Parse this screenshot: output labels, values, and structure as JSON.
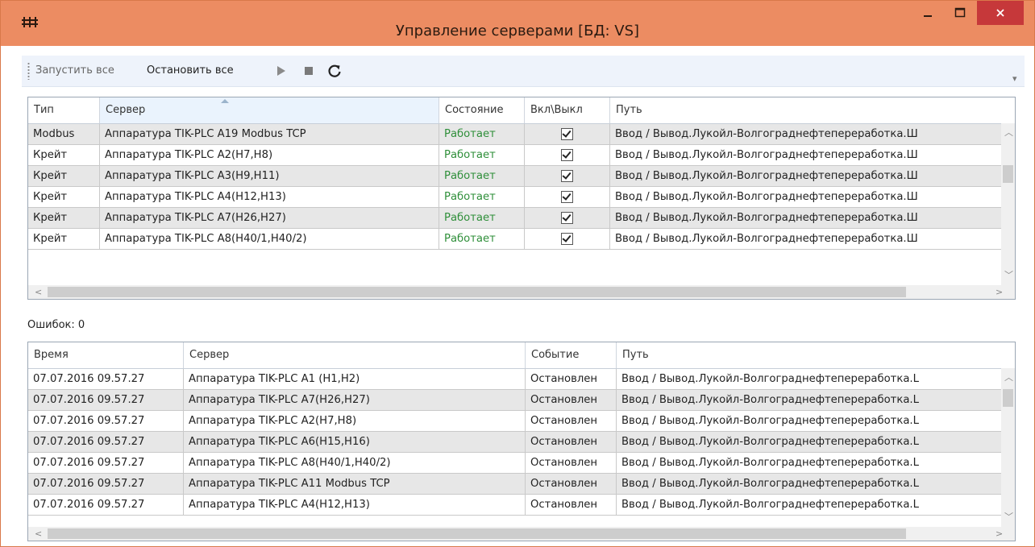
{
  "window": {
    "title": "Управление серверами [БД: VS]",
    "app_icon": "rack-icon",
    "accent": "#ec8c62",
    "close_color": "#c6383a"
  },
  "toolbar": {
    "start_all": "Запустить все",
    "stop_all": "Остановить все",
    "icons": [
      "play-icon",
      "stop-icon",
      "refresh-icon"
    ]
  },
  "servers": {
    "headers": [
      "Тип",
      "Сервер",
      "Состояние",
      "Вкл\\Выкл",
      "Путь"
    ],
    "sorted_column": "Сервер",
    "rows": [
      {
        "type": "Modbus",
        "server": "Аппаратура TIK-PLC A19 Modbus TCP",
        "state": "Работает",
        "enabled": true,
        "path": "Ввод / Вывод.Лукойл-Волгограднефтепереработка.Ш"
      },
      {
        "type": "Крейт",
        "server": "Аппаратура TIK-PLC A2(H7,H8)",
        "state": "Работает",
        "enabled": true,
        "path": "Ввод / Вывод.Лукойл-Волгограднефтепереработка.Ш"
      },
      {
        "type": "Крейт",
        "server": "Аппаратура TIK-PLC A3(H9,H11)",
        "state": "Работает",
        "enabled": true,
        "path": "Ввод / Вывод.Лукойл-Волгограднефтепереработка.Ш"
      },
      {
        "type": "Крейт",
        "server": "Аппаратура TIK-PLC A4(H12,H13)",
        "state": "Работает",
        "enabled": true,
        "path": "Ввод / Вывод.Лукойл-Волгограднефтепереработка.Ш"
      },
      {
        "type": "Крейт",
        "server": "Аппаратура TIK-PLC A7(H26,H27)",
        "state": "Работает",
        "enabled": true,
        "path": "Ввод / Вывод.Лукойл-Волгограднефтепереработка.Ш"
      },
      {
        "type": "Крейт",
        "server": "Аппаратура TIK-PLC A8(H40/1,H40/2)",
        "state": "Работает",
        "enabled": true,
        "path": "Ввод / Вывод.Лукойл-Волгограднефтепереработка.Ш"
      }
    ]
  },
  "errors_label": "Ошибок: 0",
  "events": {
    "headers": [
      "Время",
      "Сервер",
      "Событие",
      "Путь"
    ],
    "rows": [
      {
        "time": "07.07.2016 09.57.27",
        "server": "Аппаратура TIK-PLC A1 (H1,H2)",
        "event": "Остановлен",
        "path": "Ввод / Вывод.Лукойл-Волгограднефтепереработка.L"
      },
      {
        "time": "07.07.2016 09.57.27",
        "server": "Аппаратура TIK-PLC A7(H26,H27)",
        "event": "Остановлен",
        "path": "Ввод / Вывод.Лукойл-Волгограднефтепереработка.L"
      },
      {
        "time": "07.07.2016 09.57.27",
        "server": "Аппаратура TIK-PLC A2(H7,H8)",
        "event": "Остановлен",
        "path": "Ввод / Вывод.Лукойл-Волгограднефтепереработка.L"
      },
      {
        "time": "07.07.2016 09.57.27",
        "server": "Аппаратура TIK-PLC A6(H15,H16)",
        "event": "Остановлен",
        "path": "Ввод / Вывод.Лукойл-Волгограднефтепереработка.L"
      },
      {
        "time": "07.07.2016 09.57.27",
        "server": "Аппаратура TIK-PLC A8(H40/1,H40/2)",
        "event": "Остановлен",
        "path": "Ввод / Вывод.Лукойл-Волгограднефтепереработка.L"
      },
      {
        "time": "07.07.2016 09.57.27",
        "server": "Аппаратура TIK-PLC A11 Modbus TCP",
        "event": "Остановлен",
        "path": "Ввод / Вывод.Лукойл-Волгограднефтепереработка.L"
      },
      {
        "time": "07.07.2016 09.57.27",
        "server": "Аппаратура TIK-PLC A4(H12,H13)",
        "event": "Остановлен",
        "path": "Ввод / Вывод.Лукойл-Волгограднефтепереработка.L"
      }
    ]
  }
}
